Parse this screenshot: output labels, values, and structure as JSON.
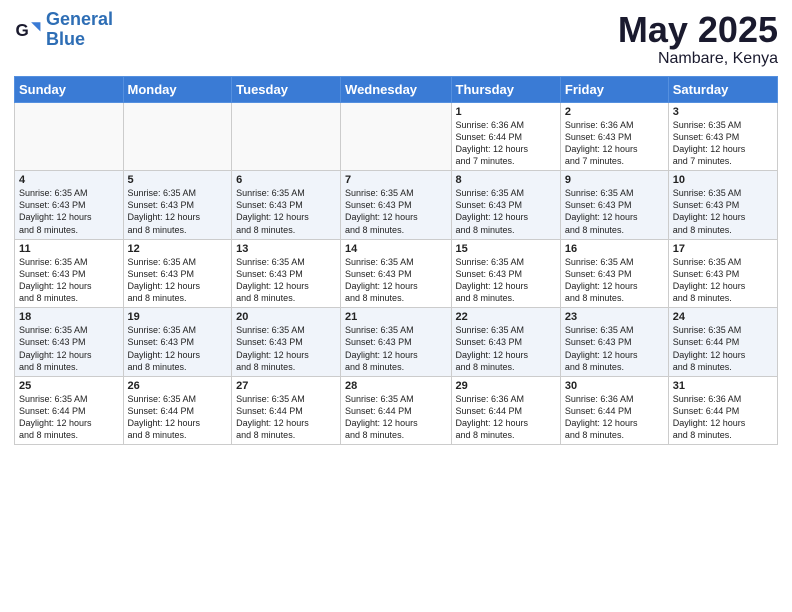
{
  "header": {
    "logo_general": "General",
    "logo_blue": "Blue",
    "title": "May 2025",
    "subtitle": "Nambare, Kenya"
  },
  "days_of_week": [
    "Sunday",
    "Monday",
    "Tuesday",
    "Wednesday",
    "Thursday",
    "Friday",
    "Saturday"
  ],
  "weeks": [
    [
      {
        "day": "",
        "info": ""
      },
      {
        "day": "",
        "info": ""
      },
      {
        "day": "",
        "info": ""
      },
      {
        "day": "",
        "info": ""
      },
      {
        "day": "1",
        "info": "Sunrise: 6:36 AM\nSunset: 6:44 PM\nDaylight: 12 hours\nand 7 minutes."
      },
      {
        "day": "2",
        "info": "Sunrise: 6:36 AM\nSunset: 6:43 PM\nDaylight: 12 hours\nand 7 minutes."
      },
      {
        "day": "3",
        "info": "Sunrise: 6:35 AM\nSunset: 6:43 PM\nDaylight: 12 hours\nand 7 minutes."
      }
    ],
    [
      {
        "day": "4",
        "info": "Sunrise: 6:35 AM\nSunset: 6:43 PM\nDaylight: 12 hours\nand 8 minutes."
      },
      {
        "day": "5",
        "info": "Sunrise: 6:35 AM\nSunset: 6:43 PM\nDaylight: 12 hours\nand 8 minutes."
      },
      {
        "day": "6",
        "info": "Sunrise: 6:35 AM\nSunset: 6:43 PM\nDaylight: 12 hours\nand 8 minutes."
      },
      {
        "day": "7",
        "info": "Sunrise: 6:35 AM\nSunset: 6:43 PM\nDaylight: 12 hours\nand 8 minutes."
      },
      {
        "day": "8",
        "info": "Sunrise: 6:35 AM\nSunset: 6:43 PM\nDaylight: 12 hours\nand 8 minutes."
      },
      {
        "day": "9",
        "info": "Sunrise: 6:35 AM\nSunset: 6:43 PM\nDaylight: 12 hours\nand 8 minutes."
      },
      {
        "day": "10",
        "info": "Sunrise: 6:35 AM\nSunset: 6:43 PM\nDaylight: 12 hours\nand 8 minutes."
      }
    ],
    [
      {
        "day": "11",
        "info": "Sunrise: 6:35 AM\nSunset: 6:43 PM\nDaylight: 12 hours\nand 8 minutes."
      },
      {
        "day": "12",
        "info": "Sunrise: 6:35 AM\nSunset: 6:43 PM\nDaylight: 12 hours\nand 8 minutes."
      },
      {
        "day": "13",
        "info": "Sunrise: 6:35 AM\nSunset: 6:43 PM\nDaylight: 12 hours\nand 8 minutes."
      },
      {
        "day": "14",
        "info": "Sunrise: 6:35 AM\nSunset: 6:43 PM\nDaylight: 12 hours\nand 8 minutes."
      },
      {
        "day": "15",
        "info": "Sunrise: 6:35 AM\nSunset: 6:43 PM\nDaylight: 12 hours\nand 8 minutes."
      },
      {
        "day": "16",
        "info": "Sunrise: 6:35 AM\nSunset: 6:43 PM\nDaylight: 12 hours\nand 8 minutes."
      },
      {
        "day": "17",
        "info": "Sunrise: 6:35 AM\nSunset: 6:43 PM\nDaylight: 12 hours\nand 8 minutes."
      }
    ],
    [
      {
        "day": "18",
        "info": "Sunrise: 6:35 AM\nSunset: 6:43 PM\nDaylight: 12 hours\nand 8 minutes."
      },
      {
        "day": "19",
        "info": "Sunrise: 6:35 AM\nSunset: 6:43 PM\nDaylight: 12 hours\nand 8 minutes."
      },
      {
        "day": "20",
        "info": "Sunrise: 6:35 AM\nSunset: 6:43 PM\nDaylight: 12 hours\nand 8 minutes."
      },
      {
        "day": "21",
        "info": "Sunrise: 6:35 AM\nSunset: 6:43 PM\nDaylight: 12 hours\nand 8 minutes."
      },
      {
        "day": "22",
        "info": "Sunrise: 6:35 AM\nSunset: 6:43 PM\nDaylight: 12 hours\nand 8 minutes."
      },
      {
        "day": "23",
        "info": "Sunrise: 6:35 AM\nSunset: 6:43 PM\nDaylight: 12 hours\nand 8 minutes."
      },
      {
        "day": "24",
        "info": "Sunrise: 6:35 AM\nSunset: 6:44 PM\nDaylight: 12 hours\nand 8 minutes."
      }
    ],
    [
      {
        "day": "25",
        "info": "Sunrise: 6:35 AM\nSunset: 6:44 PM\nDaylight: 12 hours\nand 8 minutes."
      },
      {
        "day": "26",
        "info": "Sunrise: 6:35 AM\nSunset: 6:44 PM\nDaylight: 12 hours\nand 8 minutes."
      },
      {
        "day": "27",
        "info": "Sunrise: 6:35 AM\nSunset: 6:44 PM\nDaylight: 12 hours\nand 8 minutes."
      },
      {
        "day": "28",
        "info": "Sunrise: 6:35 AM\nSunset: 6:44 PM\nDaylight: 12 hours\nand 8 minutes."
      },
      {
        "day": "29",
        "info": "Sunrise: 6:36 AM\nSunset: 6:44 PM\nDaylight: 12 hours\nand 8 minutes."
      },
      {
        "day": "30",
        "info": "Sunrise: 6:36 AM\nSunset: 6:44 PM\nDaylight: 12 hours\nand 8 minutes."
      },
      {
        "day": "31",
        "info": "Sunrise: 6:36 AM\nSunset: 6:44 PM\nDaylight: 12 hours\nand 8 minutes."
      }
    ]
  ]
}
